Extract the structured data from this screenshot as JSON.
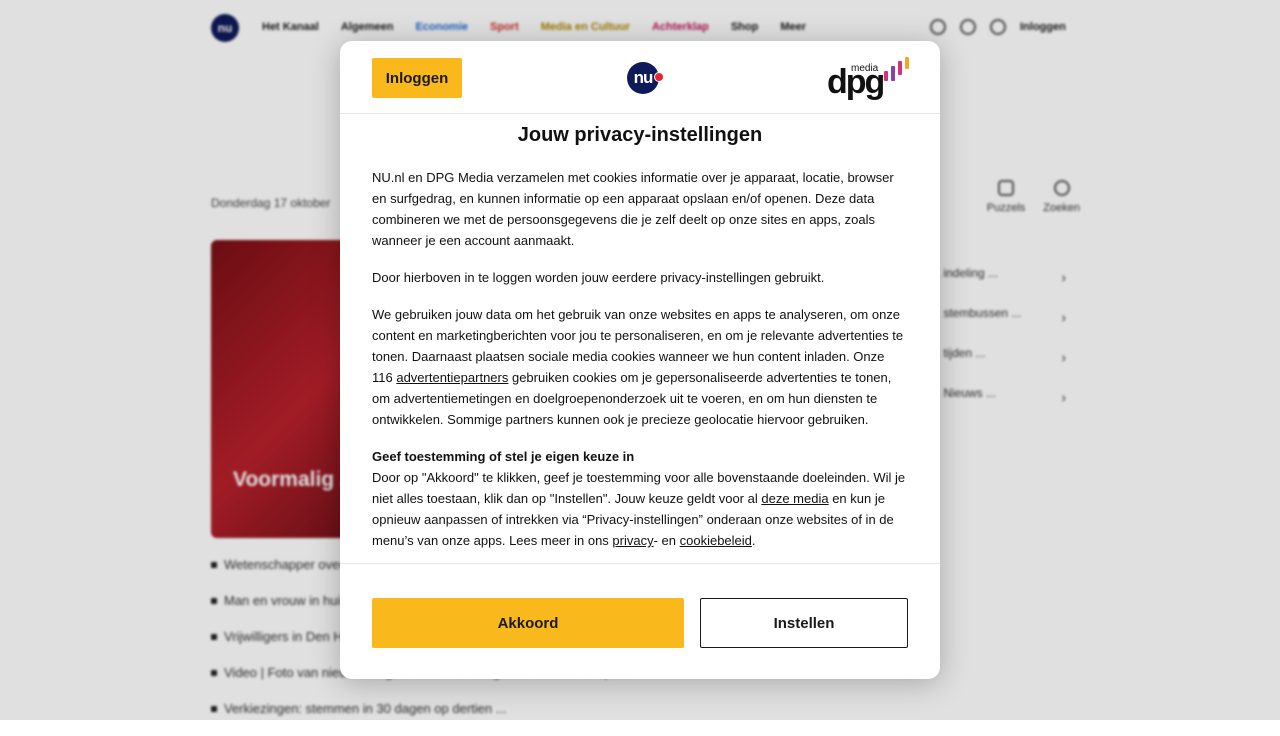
{
  "background": {
    "nav": {
      "items": [
        "Het Kanaal",
        "Algemeen",
        "Economie",
        "Sport",
        "Media en Cultuur",
        "Achterklap",
        "Shop",
        "Meer"
      ],
      "login": "Inloggen"
    },
    "date_line": "Donderdag 17 oktober",
    "hero_title": "Voormalig ... overleden",
    "bullets": [
      "Wetenschapper overleden in ziekenhuis",
      "Man en vrouw in huis gevonden",
      "Vrijwilligers in Den Haag ... bij",
      "Video | Foto van nieuwe drugs die zich vandaag door de stad verspreidt",
      "Verkiezingen: stemmen in 30 dagen op dertien ..."
    ],
    "right_icons": [
      "Puzzels",
      "Zoeken"
    ],
    "right_items": [
      "... indeling ...",
      "... stembussen ...",
      "... tijden ...",
      "... Nieuws ..."
    ]
  },
  "modal": {
    "login_button": "Inloggen",
    "nu_logo": "nu",
    "dpg_logo": "dpg",
    "dpg_media": "media",
    "title": "Jouw privacy-instellingen",
    "p1": "NU.nl en DPG Media verzamelen met cookies informatie over je apparaat, locatie, browser en surfgedrag, en kunnen informatie op een apparaat opslaan en/of openen. Deze data combineren we met de persoonsgegevens die je zelf deelt op onze sites en apps, zoals wanneer je een account aanmaakt.",
    "p2": "Door hierboven in te loggen worden jouw eerdere privacy-instellingen gebruikt.",
    "p3_before": "We gebruiken jouw data om het gebruik van onze websites en apps te analyseren, om onze content en marketingberichten voor jou te personaliseren, en om je relevante advertenties te tonen. Daarnaast plaatsen sociale media cookies wanneer we hun content inladen. Onze 116 ",
    "p3_link": "advertentiepartners",
    "p3_after": " gebruiken cookies om je gepersonaliseerde advertenties te tonen, om advertentiemetingen en doelgroepenonderzoek uit te voeren, en om hun diensten te ontwikkelen. Sommige partners kunnen ook je precieze geolocatie hiervoor gebruiken.",
    "consent_heading": "Geef toestemming of stel je eigen keuze in",
    "p4_before": "Door op \"Akkoord\" te klikken, geef je toestemming voor alle bovenstaande doeleinden. Wil je niet alles toestaan, klik dan op \"Instellen\". Jouw keuze geldt voor al ",
    "p4_link1": "deze media",
    "p4_mid": " en kun je opnieuw aanpassen of intrekken via “Privacy-instellingen” onderaan onze websites of in de menu’s van onze apps. Lees meer in ons ",
    "p4_link2": "privacy",
    "p4_mid2": "- en ",
    "p4_link3": "cookiebeleid",
    "p4_end": ".",
    "accept_button": "Akkoord",
    "settings_button": "Instellen"
  },
  "colors": {
    "accent_yellow": "#f9b91c",
    "nu_navy": "#0f1a5a",
    "nu_red": "#e8242d",
    "dpg_bar_pink": "#d6307a",
    "dpg_bar_purple": "#8b3fa8",
    "dpg_bar_orange": "#f5a623"
  }
}
